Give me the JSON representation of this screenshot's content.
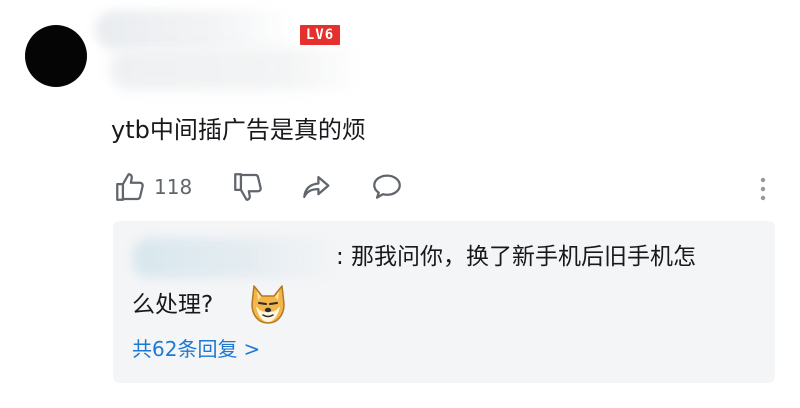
{
  "comment": {
    "level_badge": "LV6",
    "text": "ytb中间插广告是真的烦",
    "like_count": "118"
  },
  "reply": {
    "line1": ": 那我问你，换了新手机后旧手机怎",
    "line2": "么处理?",
    "emoji": "doge-emoji",
    "view_more": "共62条回复",
    "view_more_chevron": ">"
  },
  "icons": {
    "like": "thumbs-up-icon",
    "dislike": "thumbs-down-icon",
    "share": "share-icon",
    "reply": "comment-bubble-icon",
    "more": "more-vertical-icon"
  },
  "colors": {
    "badge": "#e5302d",
    "link": "#1f78d1",
    "icon": "#61666d",
    "reply_bg": "#f4f5f7"
  }
}
